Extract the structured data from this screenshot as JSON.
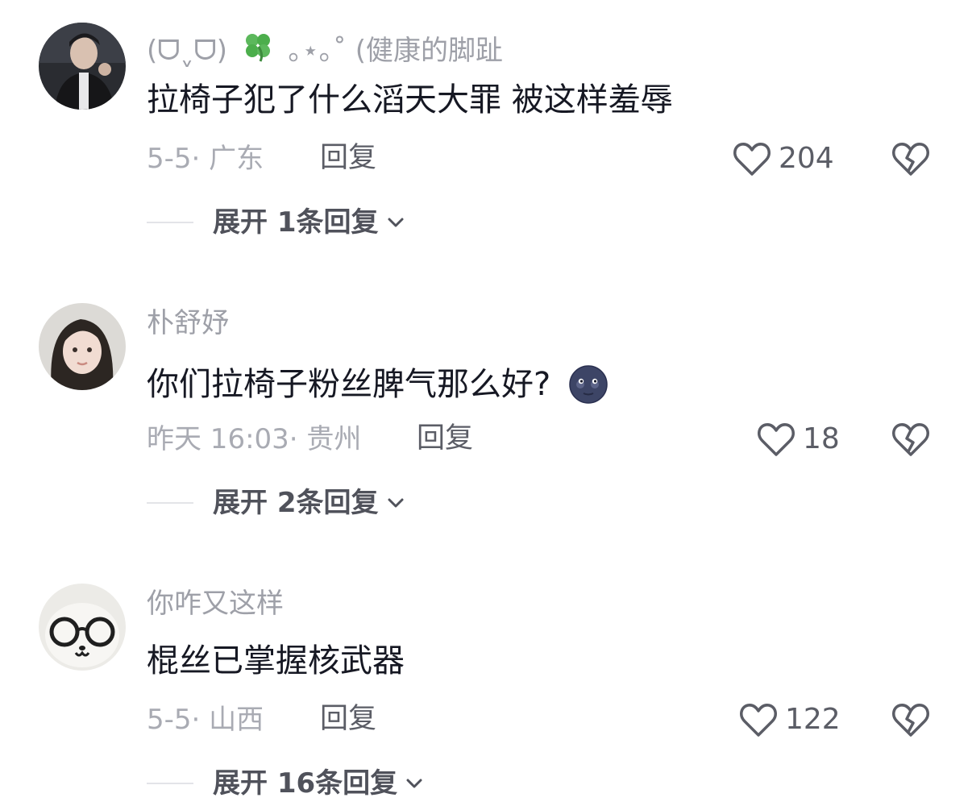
{
  "comments": [
    {
      "username": "(ᗜˬᗜ)",
      "username_suffix": "｡⋆｡˚ (健康的脚趾",
      "text": "拉椅子犯了什么滔天大罪 被这样羞辱",
      "meta": "5-5· 广东",
      "reply_label": "回复",
      "likes": "204",
      "expand_label": "展开 1条回复"
    },
    {
      "username": "朴舒妤",
      "text": "你们拉椅子粉丝脾气那么好?",
      "emoji": "new-moon-face-emoji",
      "meta": "昨天 16:03· 贵州",
      "reply_label": "回复",
      "likes": "18",
      "expand_label": "展开 2条回复"
    },
    {
      "username": "你咋又这样",
      "text": "棍丝已掌握核武器",
      "meta": "5-5· 山西",
      "reply_label": "回复",
      "likes": "122",
      "expand_label": "展开 16条回复"
    }
  ],
  "icons": {
    "like": "heart-outline-icon",
    "dislike": "broken-heart-icon",
    "expand": "chevron-down-icon",
    "clover": "four-leaf-clover-icon"
  },
  "colors": {
    "text_primary": "#161823",
    "text_secondary": "#a9abb3",
    "username": "#9ea0a8",
    "action": "#5b5d66"
  }
}
